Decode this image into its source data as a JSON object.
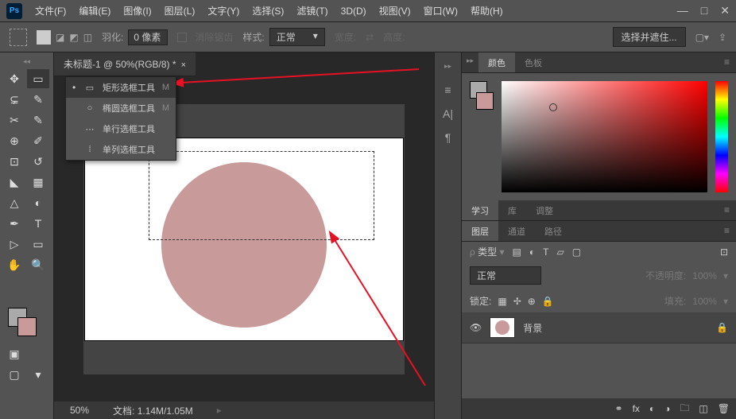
{
  "app": {
    "logo": "Ps"
  },
  "menu": [
    "文件(F)",
    "编辑(E)",
    "图像(I)",
    "图层(L)",
    "文字(Y)",
    "选择(S)",
    "滤镜(T)",
    "3D(D)",
    "视图(V)",
    "窗口(W)",
    "帮助(H)"
  ],
  "options": {
    "feather_label": "羽化:",
    "feather_value": "0 像素",
    "antialias": "消除锯齿",
    "style_label": "样式:",
    "style_value": "正常",
    "width_label": "宽度:",
    "height_label": "高度:",
    "mask_btn": "选择并遮住..."
  },
  "doc": {
    "tab": "未标题-1 @ 50%(RGB/8) *"
  },
  "flyout": {
    "items": [
      {
        "icon": "▭",
        "label": "矩形选框工具",
        "key": "M",
        "active": true
      },
      {
        "icon": "○",
        "label": "椭圆选框工具",
        "key": "M"
      },
      {
        "icon": "⋯",
        "label": "单行选框工具",
        "key": ""
      },
      {
        "icon": "⁞",
        "label": "单列选框工具",
        "key": ""
      }
    ]
  },
  "status": {
    "zoom": "50%",
    "doc_size": "文档:   1.14M/1.05M"
  },
  "color_panel": {
    "tabs": [
      "颜色",
      "色板"
    ]
  },
  "learn_tabs": [
    "学习",
    "库",
    "调整"
  ],
  "layers": {
    "tabs": [
      "图层",
      "通道",
      "路径"
    ],
    "filter_label": "类型",
    "blend": "正常",
    "opacity_label": "不透明度:",
    "opacity": "100%",
    "lock_label": "锁定:",
    "fill_label": "填充:",
    "fill": "100%",
    "bg_layer": "背景"
  }
}
